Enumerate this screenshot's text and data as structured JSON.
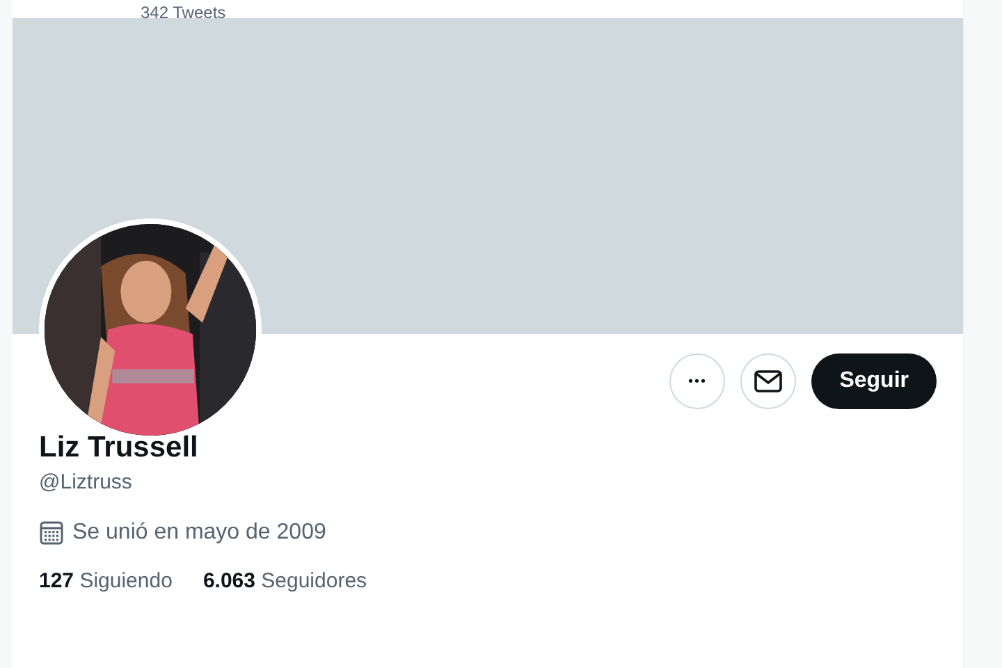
{
  "header": {
    "tweet_count": "342 Tweets"
  },
  "actions": {
    "more": "•••",
    "follow": "Seguir"
  },
  "profile": {
    "name": "Liz Trussell",
    "handle": "@Liztruss",
    "joined": "Se unió en mayo de 2009"
  },
  "stats": [
    {
      "count": "127",
      "label": "Siguiendo"
    },
    {
      "count": "6.063",
      "label": "Seguidores"
    }
  ]
}
